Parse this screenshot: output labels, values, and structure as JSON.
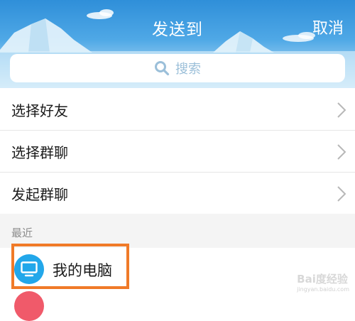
{
  "header": {
    "title": "发送到",
    "cancel_label": "取消"
  },
  "search": {
    "placeholder": "搜索",
    "icon": "search-icon"
  },
  "menu": {
    "items": [
      {
        "label": "选择好友",
        "icon": "chevron-right-icon"
      },
      {
        "label": "选择群聊",
        "icon": "chevron-right-icon"
      },
      {
        "label": "发起群聊",
        "icon": "chevron-right-icon"
      }
    ]
  },
  "recent": {
    "section_label": "最近",
    "items": [
      {
        "label": "我的电脑",
        "icon": "monitor-icon"
      }
    ]
  },
  "watermark": {
    "text": "Bai度经验",
    "sub": "jingyan.baidu.com"
  },
  "colors": {
    "header_top": "#2f8fd9",
    "avatar_blue": "#22a7ea",
    "highlight_orange": "#f07a28",
    "section_bg": "#f4f4f4"
  }
}
